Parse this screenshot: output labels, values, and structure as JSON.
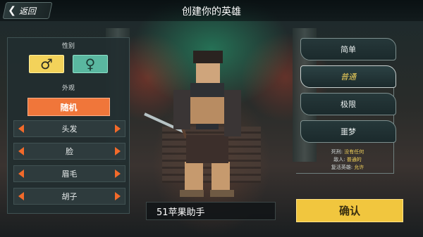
{
  "header": {
    "back_label": "返回",
    "title": "创建你的英雄",
    "back_icon": "chevron-left-icon"
  },
  "left_panel": {
    "gender_label": "性别",
    "male_symbol": "♂",
    "female_symbol": "♀",
    "appearance_label": "外观",
    "random_label": "随机",
    "options": [
      "头发",
      "脸",
      "眉毛",
      "胡子"
    ]
  },
  "difficulty": {
    "options": [
      "简单",
      "普通",
      "极限",
      "噩梦"
    ],
    "selected": "普通",
    "info": [
      {
        "key": "死刑:",
        "value": "没有任何"
      },
      {
        "key": "敌人:",
        "value": "普通的"
      },
      {
        "key": "复活英雄:",
        "value": "允许"
      }
    ]
  },
  "name_input": {
    "value": "51苹果助手"
  },
  "confirm_label": "确认",
  "colors": {
    "accent_orange": "#f0763a",
    "accent_yellow": "#f1c63e",
    "female_teal": "#5ab7a0"
  }
}
